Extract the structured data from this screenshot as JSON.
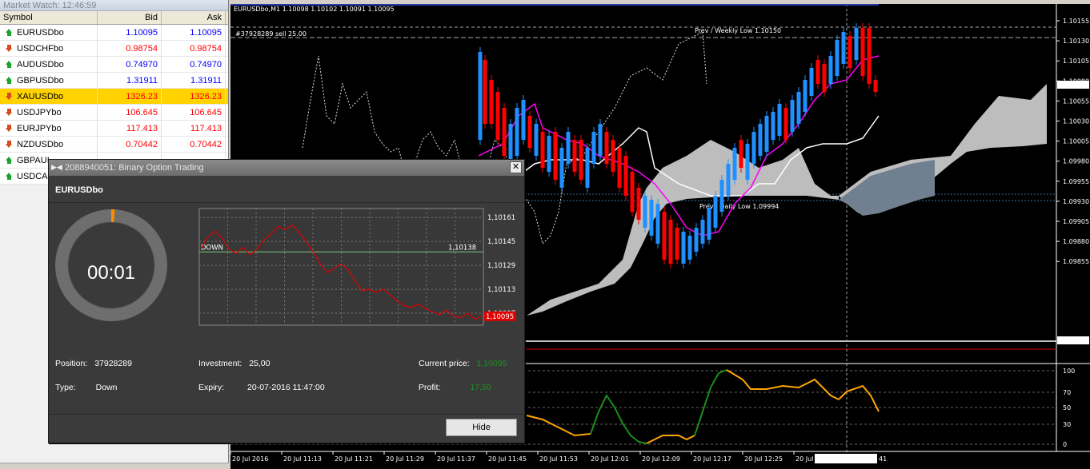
{
  "market_watch": {
    "title": "Market Watch: 12:46:59",
    "columns": [
      "Symbol",
      "Bid",
      "Ask"
    ],
    "rows": [
      {
        "symbol": "EURUSDbo",
        "bid": "1.10095",
        "ask": "1.10095",
        "dir": "up",
        "color": "blue"
      },
      {
        "symbol": "USDCHFbo",
        "bid": "0.98754",
        "ask": "0.98754",
        "dir": "down",
        "color": "red"
      },
      {
        "symbol": "AUDUSDbo",
        "bid": "0.74970",
        "ask": "0.74970",
        "dir": "up",
        "color": "blue"
      },
      {
        "symbol": "GBPUSDbo",
        "bid": "1.31911",
        "ask": "1.31911",
        "dir": "up",
        "color": "blue"
      },
      {
        "symbol": "XAUUSDbo",
        "bid": "1326.23",
        "ask": "1326.23",
        "dir": "down",
        "color": "red",
        "selected": true
      },
      {
        "symbol": "USDJPYbo",
        "bid": "106.645",
        "ask": "106.645",
        "dir": "down",
        "color": "red"
      },
      {
        "symbol": "EURJPYbo",
        "bid": "117.413",
        "ask": "117.413",
        "dir": "down",
        "color": "red"
      },
      {
        "symbol": "NZDUSDbo",
        "bid": "0.70442",
        "ask": "0.70442",
        "dir": "down",
        "color": "red"
      },
      {
        "symbol": "GBPAUI",
        "bid": "",
        "ask": "",
        "dir": "up",
        "color": "blue"
      },
      {
        "symbol": "USDCA",
        "bid": "",
        "ask": "",
        "dir": "up",
        "color": "blue"
      }
    ]
  },
  "chart": {
    "header": "EURUSDbo,M1  1.10098 1.10102 1.10091 1.10095",
    "order_label": "#37928289 sell 25.00",
    "weekly_low_label": "Prev / Weekly Low 1.10150",
    "daily_low_label": "Prev / Daily Low 1.09994",
    "price_labels": [
      "1.10155",
      "1.10130",
      "1.10105",
      "1.10080",
      "1.10055",
      "1.10030",
      "1.10005",
      "1.09980",
      "1.09955",
      "1.09930",
      "1.09905",
      "1.09880",
      "1.09855"
    ],
    "current_price": "1.10095",
    "order_price": "1.09870",
    "osc_labels": [
      "100",
      "70",
      "50",
      "30",
      "0"
    ],
    "time_labels": [
      "20 Jul 2016",
      "20 Jul 11:13",
      "20 Jul 11:21",
      "20 Jul 11:29",
      "20 Jul 11:37",
      "20 Jul 11:45",
      "20 Jul 11:53",
      "20 Jul 12:01",
      "20 Jul 12:09",
      "20 Jul 12:17",
      "20 Jul 12:25",
      "20 Jul"
    ],
    "cursor_time": "2016.07.20 12:41",
    "cursor_time_tail": "41",
    "colors": {
      "bull": "#1e90ff",
      "bear": "#ff0000",
      "magenta": "#ff00ff",
      "cloud": "#bdbdbd",
      "cloud_dark": "#708090",
      "osc_up": "#1a8f1a",
      "osc_down": "#ffa500"
    }
  },
  "dialog": {
    "title": "2088940051: Binary Option Trading",
    "symbol": "EURUSDbo",
    "timer": "00:01",
    "timer_progress": 0.01,
    "mini_chart": {
      "price_labels": [
        "1,10161",
        "1,10145",
        "1,10129",
        "1,10113",
        "1,10097"
      ],
      "direction": "DOWN",
      "strike_label": "1,10138",
      "current_label": "1,10095",
      "values": [
        1.1014,
        1.10148,
        1.10152,
        1.10147,
        1.1014,
        1.10137,
        1.10141,
        1.10136,
        1.1014,
        1.10146,
        1.1015,
        1.10155,
        1.10153,
        1.10156,
        1.10151,
        1.10145,
        1.10138,
        1.1013,
        1.10124,
        1.10127,
        1.1013,
        1.10126,
        1.10118,
        1.10112,
        1.10113,
        1.10111,
        1.10113,
        1.10109,
        1.10105,
        1.10102,
        1.10101,
        1.10103,
        1.101,
        1.10098,
        1.10096,
        1.10099,
        1.10095,
        1.10094,
        1.10097,
        1.10093,
        1.10095
      ]
    },
    "position_label": "Position:",
    "position_value": "37928289",
    "type_label": "Type:",
    "type_value": "Down",
    "investment_label": "Investment:",
    "investment_value": "25,00",
    "expiry_label": "Expiry:",
    "expiry_value": "20-07-2016 11:47:00",
    "current_price_label": "Current price:",
    "current_price_value": "1,10095",
    "profit_label": "Profit:",
    "profit_value": "17,50",
    "hide_label": "Hide"
  }
}
